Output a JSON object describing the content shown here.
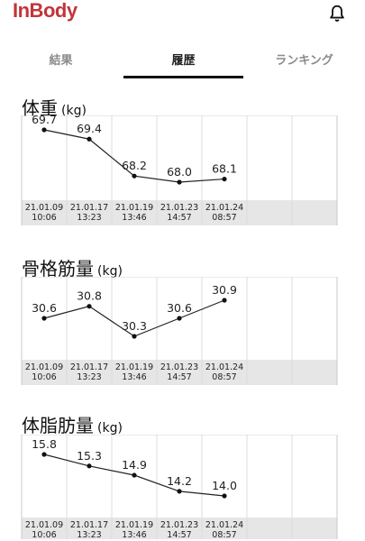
{
  "app": {
    "brand": "InBody"
  },
  "tabs": [
    {
      "label": "結果",
      "active": false
    },
    {
      "label": "履歴",
      "active": true
    },
    {
      "label": "ランキング",
      "active": false
    }
  ],
  "dates": [
    [
      "21.01.09",
      "10:06"
    ],
    [
      "21.01.17",
      "13:23"
    ],
    [
      "21.01.19",
      "13:46"
    ],
    [
      "21.01.23",
      "14:57"
    ],
    [
      "21.01.24",
      "08:57"
    ]
  ],
  "chart_data": [
    {
      "type": "line",
      "title": "体重",
      "unit": "(kg)",
      "values": [
        69.7,
        69.4,
        68.2,
        68.0,
        68.1
      ],
      "labels": [
        "69.7",
        "69.4",
        "68.2",
        "68.0",
        "68.1"
      ]
    },
    {
      "type": "line",
      "title": "骨格筋量",
      "unit": "(kg)",
      "values": [
        30.6,
        30.8,
        30.3,
        30.6,
        30.9
      ],
      "labels": [
        "30.6",
        "30.8",
        "30.3",
        "30.6",
        "30.9"
      ]
    },
    {
      "type": "line",
      "title": "体脂肪量",
      "unit": "(kg)",
      "values": [
        15.8,
        15.3,
        14.9,
        14.2,
        14.0
      ],
      "labels": [
        "15.8",
        "15.3",
        "14.9",
        "14.2",
        "14.0"
      ]
    }
  ]
}
